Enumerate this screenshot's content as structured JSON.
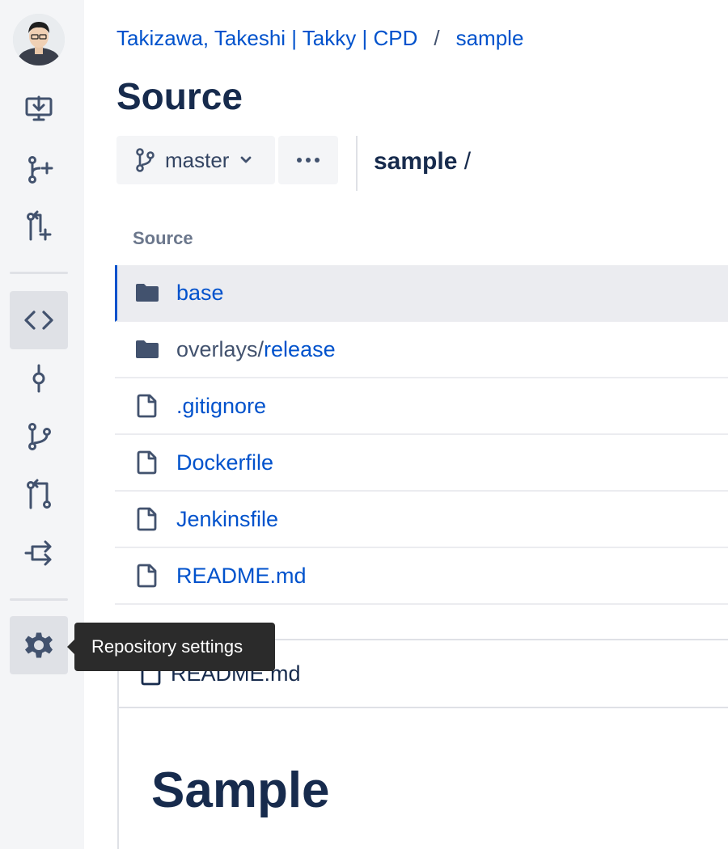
{
  "breadcrumb": {
    "workspace": "Takizawa, Takeshi | Takky | CPD",
    "separator": "/",
    "repo": "sample"
  },
  "page": {
    "title": "Source"
  },
  "toolbar": {
    "branch_label": "master",
    "more_label": "…"
  },
  "path": {
    "repo": "sample",
    "slash": " /"
  },
  "file_list": {
    "header": "Source",
    "items": [
      {
        "type": "folder",
        "name": "base"
      },
      {
        "type": "folder",
        "prefix": "overlays/",
        "name": "release"
      },
      {
        "type": "file",
        "name": ".gitignore"
      },
      {
        "type": "file",
        "name": "Dockerfile"
      },
      {
        "type": "file",
        "name": "Jenkinsfile"
      },
      {
        "type": "file",
        "name": "README.md"
      }
    ]
  },
  "readme": {
    "filename": "README.md",
    "heading": "Sample"
  },
  "tooltip": {
    "text": "Repository settings"
  },
  "sidebar": {
    "icons": [
      "clone-icon",
      "create-branch-icon",
      "create-pull-request-icon",
      "source-icon",
      "commits-icon",
      "branches-icon",
      "pull-requests-icon",
      "pipelines-icon",
      "settings-icon"
    ]
  },
  "colors": {
    "link": "#0052cc",
    "text": "#172b4d",
    "sidebar_bg": "#f4f5f7",
    "selected_bg": "#ebecf0",
    "tooltip_bg": "#2b2b2b"
  }
}
